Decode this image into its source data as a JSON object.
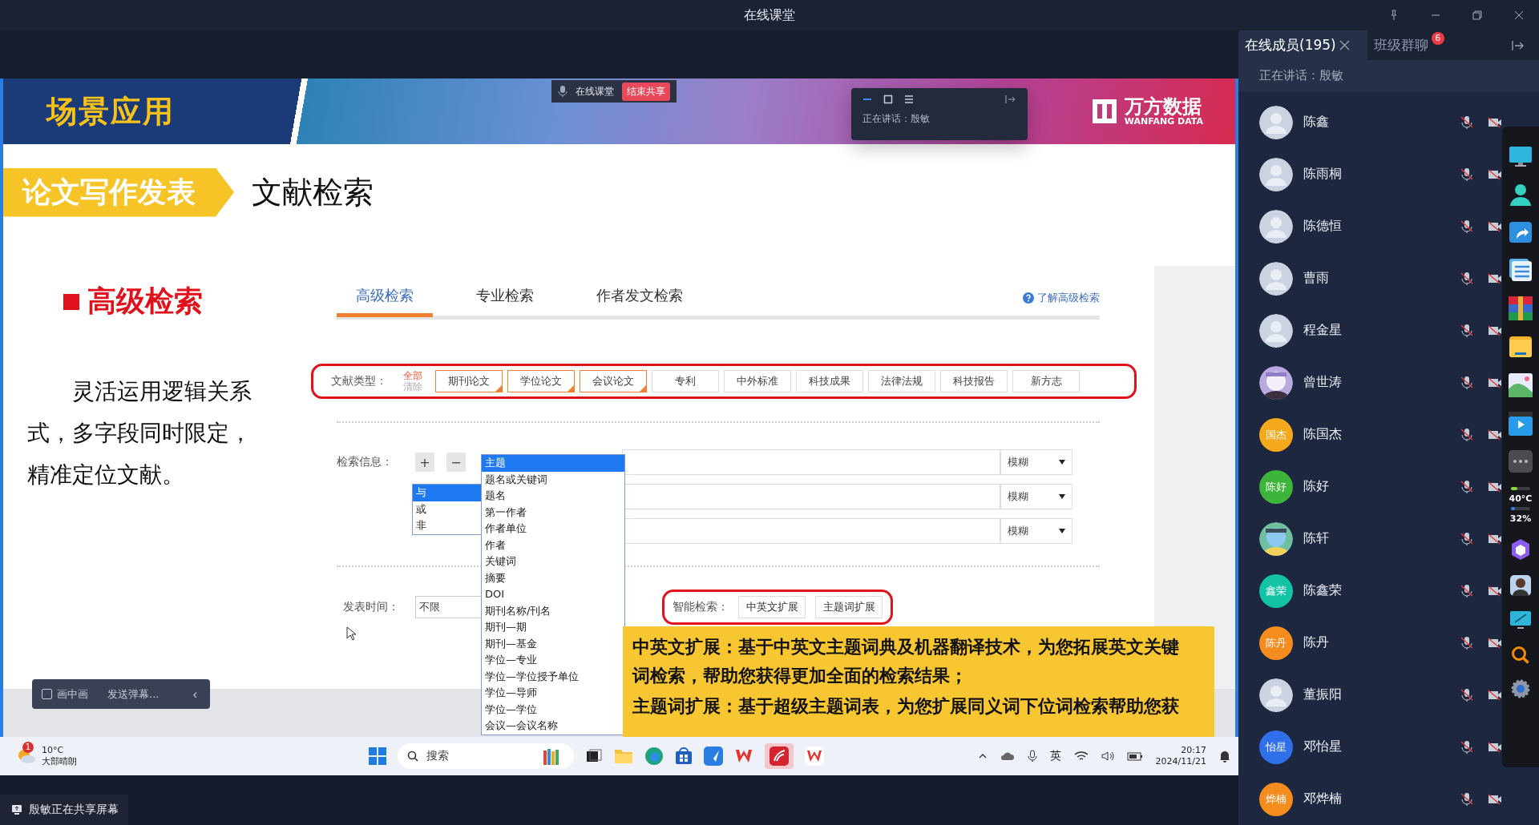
{
  "window": {
    "title": "在线课堂"
  },
  "shared_screen": {
    "share_toolbar": {
      "label": "在线课堂",
      "stop_button": "结束共享"
    },
    "mini_window": {
      "speaking": "正在讲话：殷敏"
    },
    "slide": {
      "header": "场景应用",
      "logo_name": "万方数据",
      "logo_sub": "WANFANG DATA",
      "section": "论文写作发表",
      "title": "文献检索",
      "subheading": "高级检索",
      "body": "灵活运用逻辑关系式，多字段同时限定，精准定位文献。",
      "search_page": {
        "tabs": [
          {
            "label": "高级检索",
            "selected": true
          },
          {
            "label": "专业检索",
            "selected": false
          },
          {
            "label": "作者发文检索",
            "selected": false
          }
        ],
        "help_link": "了解高级检索",
        "doc_type_label": "文献类型：",
        "select_all": "全部",
        "clear": "清除",
        "doc_types": [
          {
            "label": "期刊论文",
            "checked": true
          },
          {
            "label": "学位论文",
            "checked": true
          },
          {
            "label": "会议论文",
            "checked": true
          },
          {
            "label": "专利",
            "checked": false
          },
          {
            "label": "中外标准",
            "checked": false
          },
          {
            "label": "科技成果",
            "checked": false
          },
          {
            "label": "法律法规",
            "checked": false
          },
          {
            "label": "科技报告",
            "checked": false
          },
          {
            "label": "新方志",
            "checked": false
          }
        ],
        "search_info_label": "检索信息：",
        "add_button": "+",
        "remove_button": "−",
        "match_selects": [
          "模糊",
          "模糊",
          "模糊"
        ],
        "field_options": [
          {
            "label": "主题",
            "selected": true
          },
          {
            "label": "题名或关键词",
            "selected": false
          },
          {
            "label": "题名",
            "selected": false
          },
          {
            "label": "第一作者",
            "selected": false
          },
          {
            "label": "作者单位",
            "selected": false
          },
          {
            "label": "作者",
            "selected": false
          },
          {
            "label": "关键词",
            "selected": false
          },
          {
            "label": "摘要",
            "selected": false
          },
          {
            "label": "DOI",
            "selected": false
          },
          {
            "label": "期刊名称/刊名",
            "selected": false
          },
          {
            "label": "期刊—期",
            "selected": false
          },
          {
            "label": "期刊—基金",
            "selected": false
          },
          {
            "label": "学位—专业",
            "selected": false
          },
          {
            "label": "学位—学位授予单位",
            "selected": false
          },
          {
            "label": "学位—导师",
            "selected": false
          },
          {
            "label": "学位—学位",
            "selected": false
          },
          {
            "label": "会议—会议名称",
            "selected": false
          }
        ],
        "logic_options": [
          {
            "label": "与",
            "selected": true
          },
          {
            "label": "或",
            "selected": false
          },
          {
            "label": "非",
            "selected": false
          }
        ],
        "date_label": "发表时间：",
        "date_value": "不限",
        "smart_label": "智能检索：",
        "smart_buttons": [
          "中英文扩展",
          "主题词扩展"
        ]
      },
      "callout": [
        "中英文扩展：基于中英文主题词典及机器翻译技术，为您拓展英文关键词检索，帮助您获得更加全面的检索结果；",
        "主题词扩展：基于超级主题词表，为您扩展同义词下位词检索帮助您获"
      ]
    },
    "pip_bar": {
      "pip_label": "画中画",
      "pip_checked": false,
      "danmaku": "发送弹幕...",
      "collapse": "‹"
    },
    "taskbar": {
      "weather_badge": "1",
      "temperature": "10°C",
      "weather": "大部晴朗",
      "search_placeholder": "搜索",
      "input_method": "英",
      "time": "20:17",
      "date": "2024/11/21"
    }
  },
  "status": "殷敏正在共享屏幕",
  "members_panel": {
    "tabs": [
      {
        "label": "在线成员(195)",
        "selected": true
      },
      {
        "label": "班级群聊",
        "selected": false,
        "badge": "6"
      }
    ],
    "speaking": "正在讲话：殷敏",
    "members": [
      {
        "name": "陈鑫",
        "kind": "default"
      },
      {
        "name": "陈雨桐",
        "kind": "default"
      },
      {
        "name": "陈德恒",
        "kind": "default"
      },
      {
        "name": "曹雨",
        "kind": "default"
      },
      {
        "name": "程金星",
        "kind": "default"
      },
      {
        "name": "曾世涛",
        "kind": "picture"
      },
      {
        "name": "陈国杰",
        "kind": "initials",
        "initials": "国杰",
        "color": "#f7a91d"
      },
      {
        "name": "陈好",
        "kind": "initials",
        "initials": "陈好",
        "color": "#3db53a"
      },
      {
        "name": "陈轩",
        "kind": "picture"
      },
      {
        "name": "陈鑫荣",
        "kind": "initials",
        "initials": "鑫荣",
        "color": "#13c3a6"
      },
      {
        "name": "陈丹",
        "kind": "initials",
        "initials": "陈丹",
        "color": "#f58c1e"
      },
      {
        "name": "董振阳",
        "kind": "default"
      },
      {
        "name": "邓怡星",
        "kind": "initials",
        "initials": "怡星",
        "color": "#2f6fea"
      },
      {
        "name": "邓烨楠",
        "kind": "initials",
        "initials": "烨楠",
        "color": "#f58c1e"
      }
    ]
  },
  "dock": {
    "temperature": {
      "reading": "40°C",
      "level": 0.35
    },
    "cpu": {
      "reading": "32%",
      "level": 0.2
    }
  }
}
